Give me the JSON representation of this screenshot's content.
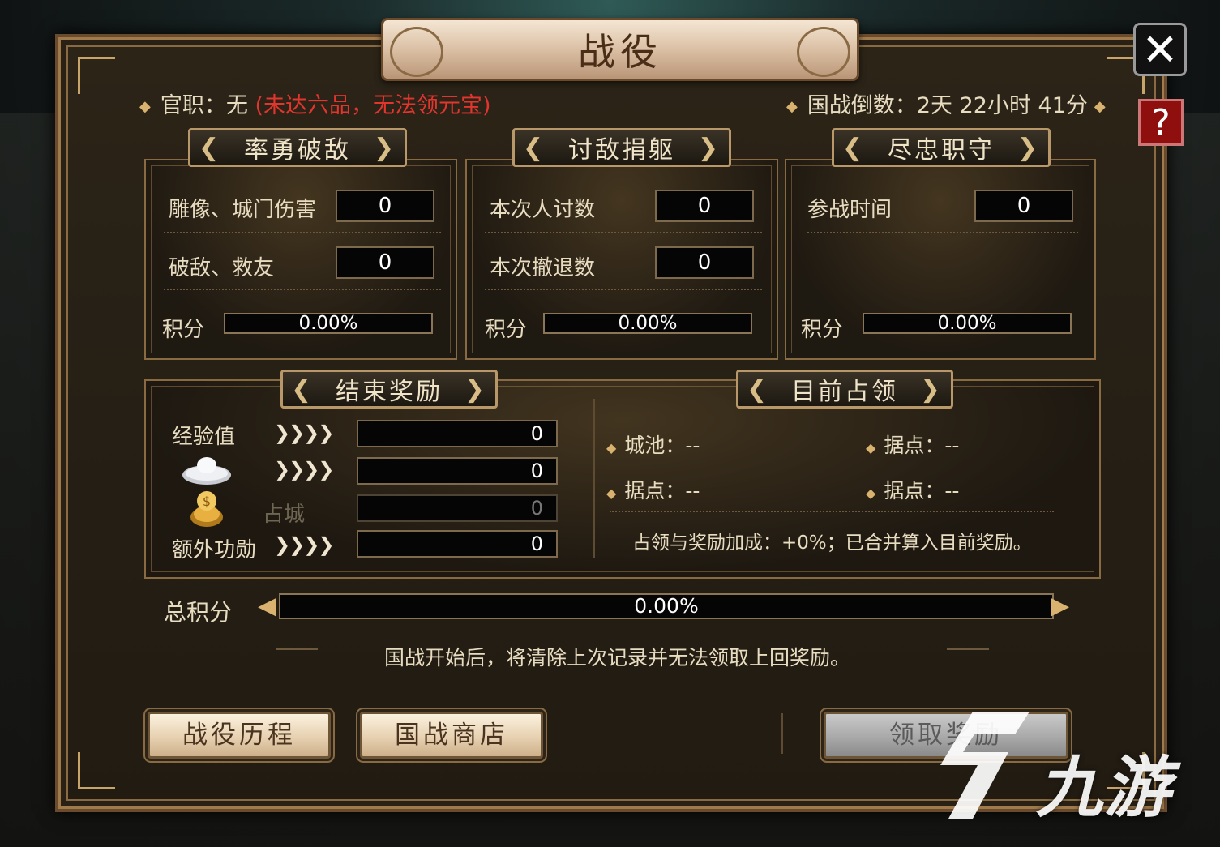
{
  "title": "战役",
  "header": {
    "rank_label": "官职：",
    "rank_value": "无",
    "rank_warning": "(未达六品，无法领元宝)",
    "countdown_label": "国战倒数：",
    "countdown_value": "2天 22小时 41分"
  },
  "sections": [
    {
      "title": "率勇破敌",
      "rows": [
        {
          "label": "雕像、城门伤害",
          "value": "0"
        },
        {
          "label": "破敌、救友",
          "value": "0"
        }
      ],
      "score_label": "积分",
      "score": "0.00%"
    },
    {
      "title": "讨敌捐躯",
      "rows": [
        {
          "label": "本次人讨数",
          "value": "0"
        },
        {
          "label": "本次撤退数",
          "value": "0"
        }
      ],
      "score_label": "积分",
      "score": "0.00%"
    },
    {
      "title": "尽忠职守",
      "rows": [
        {
          "label": "参战时间",
          "value": "0"
        }
      ],
      "score_label": "积分",
      "score": "0.00%"
    }
  ],
  "rewards": {
    "title": "结束奖励",
    "rows": [
      {
        "label": "经验值",
        "value": "0"
      },
      {
        "label": "",
        "icon": "silver-ingot",
        "value": "0"
      },
      {
        "label": "占城",
        "icon": "gold-ingot",
        "value": "0"
      },
      {
        "label": "额外功勋",
        "value": "0"
      }
    ]
  },
  "occupation": {
    "title": "目前占领",
    "items": [
      "城池：--",
      "据点：--",
      "据点：--",
      "据点：--"
    ],
    "note": "占领与奖励加成：+0%；已合并算入目前奖励。"
  },
  "total": {
    "label": "总积分",
    "value": "0.00%"
  },
  "notice": "国战开始后，将清除上次记录并无法领取上回奖励。",
  "buttons": {
    "history": "战役历程",
    "shop": "国战商店",
    "claim": "领取奖励"
  },
  "watermark": "九游",
  "colors": {
    "warning": "#e2352e",
    "panel": "#2c2417",
    "gold_trim": "#c9a46a",
    "help_button": "#8f0e0e"
  }
}
